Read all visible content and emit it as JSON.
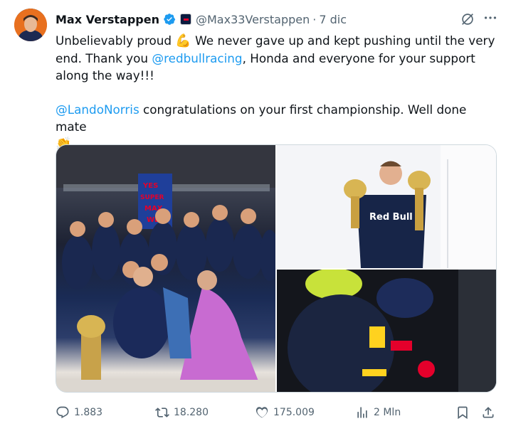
{
  "author": {
    "name": "Max Verstappen",
    "handle": "@Max33Verstappen",
    "date": "7 dic",
    "separator": "·"
  },
  "tweet": {
    "line1_a": "Unbelievably proud ",
    "line1_emoji": "💪",
    "line1_b": " We never gave up and kept pushing until the very end. Thank you ",
    "mention1": "@redbullracing",
    "line1_c": ", Honda and everyone for your support along the way!!!",
    "mention2": "@LandoNorris",
    "line2_a": " congratulations on your first championship. Well done mate",
    "line2_emoji": "👏"
  },
  "media": {
    "images": [
      {
        "label": "team-celebration-photo"
      },
      {
        "label": "trophies-photo"
      },
      {
        "label": "hug-photo"
      }
    ],
    "text_in_image": {
      "sign": [
        "YES",
        "SUPER",
        "MAX",
        "WE"
      ],
      "shirt_brand": "Red Bull"
    }
  },
  "stats": {
    "replies": "1.883",
    "reposts": "18.280",
    "likes": "175.009",
    "views": "2 Mln"
  },
  "icons": {
    "verified": "verified-badge-icon",
    "grok": "grok-icon",
    "more": "more-icon",
    "reply": "reply-icon",
    "repost": "repost-icon",
    "like": "heart-icon",
    "views": "views-icon",
    "bookmark": "bookmark-icon",
    "share": "share-icon"
  },
  "colors": {
    "accent": "#1d9bf0",
    "muted": "#536471",
    "text": "#0f1419"
  }
}
